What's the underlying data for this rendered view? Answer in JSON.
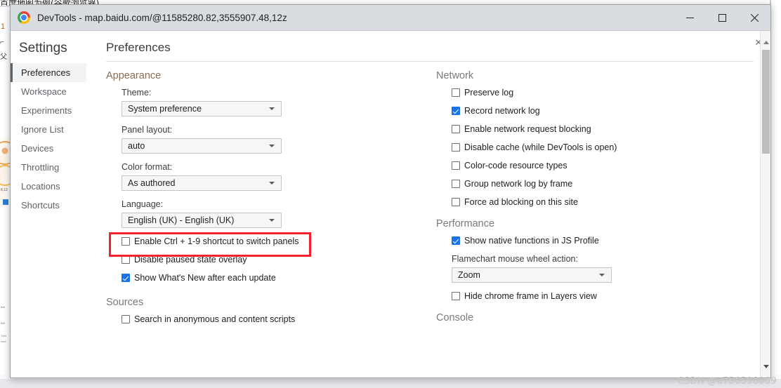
{
  "background": {
    "cn_heading": "百度地图为例(谷歌浏览器)",
    "line_number": "1",
    "glyph_a": "⌐",
    "glyph_b": "父",
    "map_label": "8,12",
    "fine_lines": [
      "fich",
      "fich",
      "Ther",
      "core"
    ]
  },
  "window": {
    "title": "DevTools - map.baidu.com/@11585280.82,3555907.48,12z",
    "controls": {
      "minimize": "minimize-button",
      "maximize": "maximize-button",
      "close": "close-button"
    }
  },
  "panel": {
    "close_label": "✕"
  },
  "sidebar": {
    "title": "Settings",
    "items": [
      {
        "label": "Preferences",
        "selected": true
      },
      {
        "label": "Workspace",
        "selected": false
      },
      {
        "label": "Experiments",
        "selected": false
      },
      {
        "label": "Ignore List",
        "selected": false
      },
      {
        "label": "Devices",
        "selected": false
      },
      {
        "label": "Throttling",
        "selected": false
      },
      {
        "label": "Locations",
        "selected": false
      },
      {
        "label": "Shortcuts",
        "selected": false
      }
    ]
  },
  "content": {
    "title": "Preferences",
    "left_column": {
      "appearance": {
        "heading": "Appearance",
        "theme_label": "Theme:",
        "theme_value": "System preference",
        "panel_layout_label": "Panel layout:",
        "panel_layout_value": "auto",
        "color_format_label": "Color format:",
        "color_format_value": "As authored",
        "language_label": "Language:",
        "language_value": "English (UK) - English (UK)",
        "checkboxes": [
          {
            "label": "Enable Ctrl + 1-9 shortcut to switch panels",
            "checked": false
          },
          {
            "label": "Disable paused state overlay",
            "checked": false
          },
          {
            "label": "Show What's New after each update",
            "checked": true
          }
        ]
      },
      "sources": {
        "heading": "Sources",
        "checkboxes": [
          {
            "label": "Search in anonymous and content scripts",
            "checked": false
          }
        ]
      }
    },
    "right_column": {
      "network": {
        "heading": "Network",
        "checkboxes": [
          {
            "label": "Preserve log",
            "checked": false
          },
          {
            "label": "Record network log",
            "checked": true
          },
          {
            "label": "Enable network request blocking",
            "checked": false
          },
          {
            "label": "Disable cache (while DevTools is open)",
            "checked": false
          },
          {
            "label": "Color-code resource types",
            "checked": false
          },
          {
            "label": "Group network log by frame",
            "checked": false
          },
          {
            "label": "Force ad blocking on this site",
            "checked": false
          }
        ]
      },
      "performance": {
        "heading": "Performance",
        "checkbox_top": {
          "label": "Show native functions in JS Profile",
          "checked": true
        },
        "flamechart_label": "Flamechart mouse wheel action:",
        "flamechart_value": "Zoom",
        "checkbox_bottom": {
          "label": "Hide chrome frame in Layers view",
          "checked": false
        }
      },
      "console": {
        "heading": "Console"
      }
    }
  },
  "annotation": {
    "highlight_color": "#f5222d",
    "highlight_target": "language_value"
  },
  "watermark": {
    "text": "CSDN @a756598009"
  },
  "colors": {
    "titlebar": "#d9dce1",
    "accent_checkbox": "#1a73e8",
    "section_heading": "#8a6b56",
    "selected_sidebar_bg": "#f1f3f4"
  }
}
